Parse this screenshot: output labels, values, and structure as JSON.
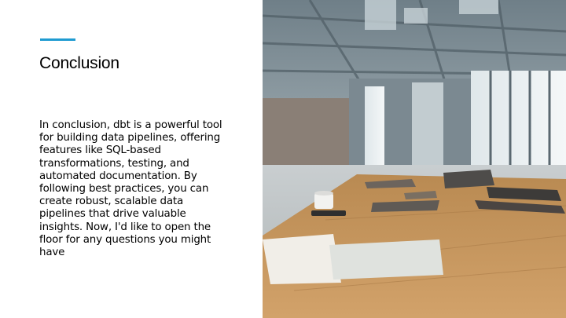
{
  "slide": {
    "title": "Conclusion",
    "body": "In conclusion, dbt is a powerful tool for building data pipelines, offering features like SQL-based transformations, testing, and automated documentation. By following best practices, you can create robust, scalable data pipelines that drive valuable insights. Now, I'd like to open the floor for any questions you might have",
    "accent_color": "#1f9bd1"
  },
  "photo": {
    "icon": "office-table-photo"
  }
}
